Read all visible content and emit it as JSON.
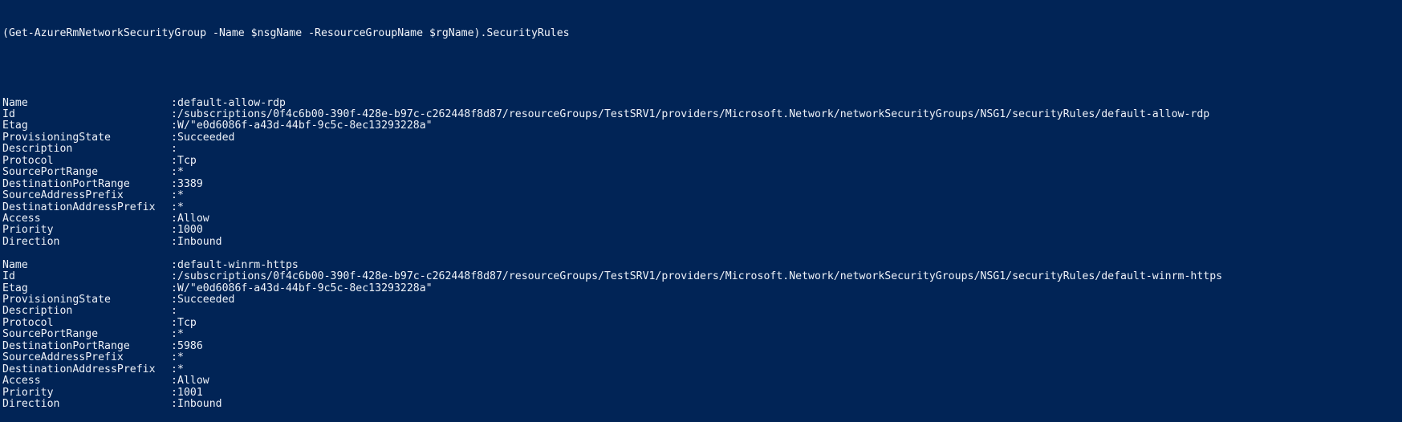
{
  "console": {
    "background_color": "#012456",
    "foreground_color": "#eef2f8",
    "command_line": "(Get-AzureRmNetworkSecurityGroup -Name $nsgName -ResourceGroupName $rgName).SecurityRules",
    "separator": ":",
    "blocks": [
      {
        "id": "security-rule-1",
        "properties": [
          {
            "name": "Name",
            "value": "default-allow-rdp"
          },
          {
            "name": "Id",
            "value": "/subscriptions/0f4c6b00-390f-428e-b97c-c262448f8d87/resourceGroups/TestSRV1/providers/Microsoft.Network/networkSecurityGroups/NSG1/securityRules/default-allow-rdp"
          },
          {
            "name": "Etag",
            "value": "W/\"e0d6086f-a43d-44bf-9c5c-8ec13293228a\""
          },
          {
            "name": "ProvisioningState",
            "value": "Succeeded"
          },
          {
            "name": "Description",
            "value": ""
          },
          {
            "name": "Protocol",
            "value": "Tcp"
          },
          {
            "name": "SourcePortRange",
            "value": "*"
          },
          {
            "name": "DestinationPortRange",
            "value": "3389"
          },
          {
            "name": "SourceAddressPrefix",
            "value": "*"
          },
          {
            "name": "DestinationAddressPrefix",
            "value": "*"
          },
          {
            "name": "Access",
            "value": "Allow"
          },
          {
            "name": "Priority",
            "value": "1000"
          },
          {
            "name": "Direction",
            "value": "Inbound"
          }
        ]
      },
      {
        "id": "security-rule-2",
        "properties": [
          {
            "name": "Name",
            "value": "default-winrm-https"
          },
          {
            "name": "Id",
            "value": "/subscriptions/0f4c6b00-390f-428e-b97c-c262448f8d87/resourceGroups/TestSRV1/providers/Microsoft.Network/networkSecurityGroups/NSG1/securityRules/default-winrm-https"
          },
          {
            "name": "Etag",
            "value": "W/\"e0d6086f-a43d-44bf-9c5c-8ec13293228a\""
          },
          {
            "name": "ProvisioningState",
            "value": "Succeeded"
          },
          {
            "name": "Description",
            "value": ""
          },
          {
            "name": "Protocol",
            "value": "Tcp"
          },
          {
            "name": "SourcePortRange",
            "value": "*"
          },
          {
            "name": "DestinationPortRange",
            "value": "5986"
          },
          {
            "name": "SourceAddressPrefix",
            "value": "*"
          },
          {
            "name": "DestinationAddressPrefix",
            "value": "*"
          },
          {
            "name": "Access",
            "value": "Allow"
          },
          {
            "name": "Priority",
            "value": "1001"
          },
          {
            "name": "Direction",
            "value": "Inbound"
          }
        ]
      }
    ]
  }
}
